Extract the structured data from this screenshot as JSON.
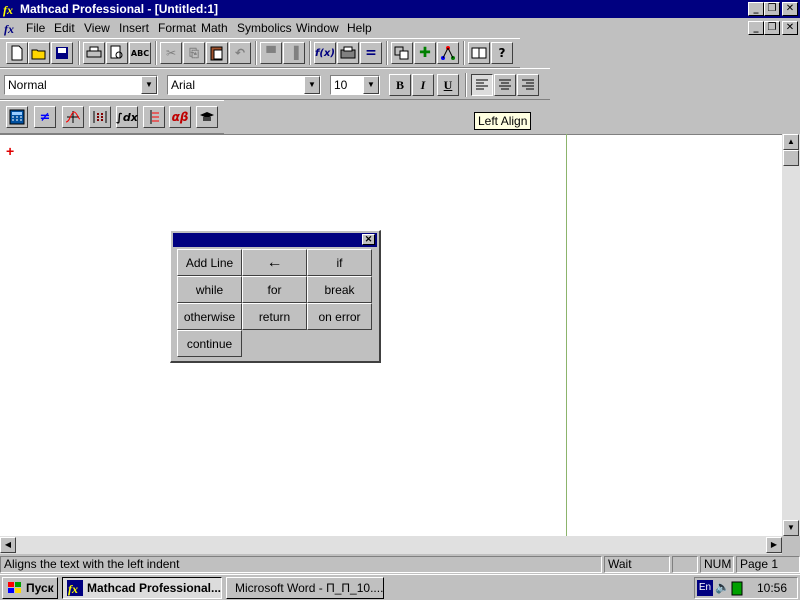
{
  "window": {
    "title": "Mathcad Professional - [Untitled:1]",
    "caption_buttons": [
      "_",
      "❐",
      "✕"
    ],
    "doc_caption_buttons": [
      "_",
      "❐",
      "✕"
    ]
  },
  "menu": [
    "File",
    "Edit",
    "View",
    "Insert",
    "Format",
    "Math",
    "Symbolics",
    "Window",
    "Help"
  ],
  "standard_toolbar": {
    "buttons": [
      {
        "name": "new-icon",
        "glyph": "🗋"
      },
      {
        "name": "open-icon",
        "glyph": "📂"
      },
      {
        "name": "save-icon",
        "glyph": "💾"
      },
      {
        "name": "print-icon",
        "glyph": "🖶"
      },
      {
        "name": "print-preview-icon",
        "glyph": "🔍"
      },
      {
        "name": "spellcheck-icon",
        "glyph": "✓"
      },
      {
        "name": "cut-icon",
        "glyph": "✂"
      },
      {
        "name": "copy-icon",
        "glyph": "⎘"
      },
      {
        "name": "paste-icon",
        "glyph": "📋"
      },
      {
        "name": "undo-icon",
        "glyph": "↶"
      },
      {
        "name": "align-across-icon",
        "glyph": "▀"
      },
      {
        "name": "align-down-icon",
        "glyph": "▐"
      },
      {
        "name": "insert-function-icon",
        "glyph": "f(x)"
      },
      {
        "name": "insert-unit-icon",
        "glyph": "⛟"
      },
      {
        "name": "calculate-icon",
        "glyph": "="
      },
      {
        "name": "insert-component-icon",
        "glyph": "⧉"
      },
      {
        "name": "resource-center-icon",
        "glyph": "✚"
      },
      {
        "name": "collaboratory-icon",
        "glyph": "⚗"
      },
      {
        "name": "quicksheets-icon",
        "glyph": "📖"
      },
      {
        "name": "help-icon",
        "glyph": "?"
      }
    ]
  },
  "format_toolbar": {
    "style": "Normal",
    "font": "Arial",
    "size": "10",
    "bold": "B",
    "italic": "I",
    "underline": "U"
  },
  "math_toolbar": {
    "buttons": [
      "calculator-icon",
      "boolean-icon",
      "graph-icon",
      "matrix-icon",
      "calculus-icon",
      "programming-icon",
      "greek-icon",
      "symbolic-icon"
    ]
  },
  "tooltip": "Left Align",
  "palette": {
    "buttons": [
      "Add Line",
      "←",
      "if",
      "while",
      "for",
      "break",
      "otherwise",
      "return",
      "on error",
      "continue"
    ]
  },
  "status": {
    "message": "Aligns the text with the left indent",
    "state": "Wait",
    "num": "NUM",
    "page": "Page 1"
  },
  "taskbar": {
    "start": "Пуск",
    "tasks": [
      "Mathcad Professional...",
      "Microsoft Word - П_П_10...."
    ],
    "lang": "En",
    "time": "10:56"
  },
  "colors": {
    "titlebar": "#000080",
    "face": "#c0c0c0",
    "page_guide": "#8cb46c",
    "cursor": "#e00000"
  }
}
